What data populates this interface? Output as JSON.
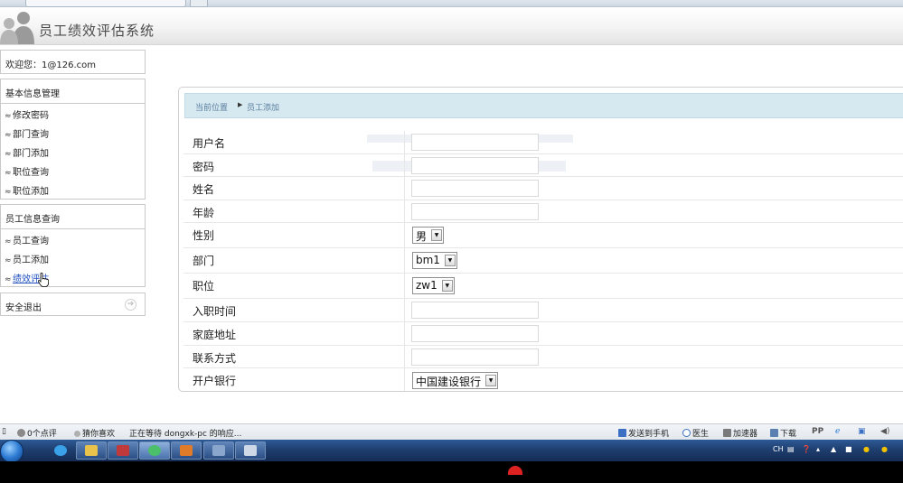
{
  "app": {
    "title": "员工绩效评估系统"
  },
  "welcome": {
    "text": "欢迎您：1@126.com"
  },
  "sidebar": {
    "groups": [
      {
        "title": "基本信息管理",
        "items": [
          {
            "label": "修改密码"
          },
          {
            "label": "部门查询"
          },
          {
            "label": "部门添加"
          },
          {
            "label": "职位查询"
          },
          {
            "label": "职位添加"
          }
        ]
      },
      {
        "title": "员工信息查询",
        "items": [
          {
            "label": "员工查询"
          },
          {
            "label": "员工添加"
          },
          {
            "label": "绩效评估"
          }
        ]
      }
    ],
    "logout": {
      "label": "安全退出"
    }
  },
  "breadcrumb": {
    "location": "当前位置",
    "page": "员工添加"
  },
  "form": {
    "username": {
      "label": "用户名",
      "value": ""
    },
    "password": {
      "label": "密码",
      "value": ""
    },
    "name": {
      "label": "姓名",
      "value": ""
    },
    "age": {
      "label": "年龄",
      "value": ""
    },
    "gender": {
      "label": "性别",
      "selected": "男"
    },
    "department": {
      "label": "部门",
      "selected": "bm1"
    },
    "position": {
      "label": "职位",
      "selected": "zw1"
    },
    "hire_date": {
      "label": "入职时间",
      "value": ""
    },
    "address": {
      "label": "家庭地址",
      "value": ""
    },
    "contact": {
      "label": "联系方式",
      "value": ""
    },
    "bank": {
      "label": "开户银行",
      "selected": "中国建设银行"
    }
  },
  "statusbar": {
    "reviews": "0个点评",
    "guess": "猜你喜欢",
    "loading": "正在等待 dongxk-pc 的响应...",
    "send_phone": "发送到手机",
    "doctor": "医生",
    "accelerator": "加速器",
    "download": "下载"
  },
  "taskbar": {
    "lang": "CH"
  },
  "colors": {
    "breadcrumb_bg": "#d7e9f0",
    "taskbar": "#1f3f70",
    "link": "#1f4fbf"
  }
}
